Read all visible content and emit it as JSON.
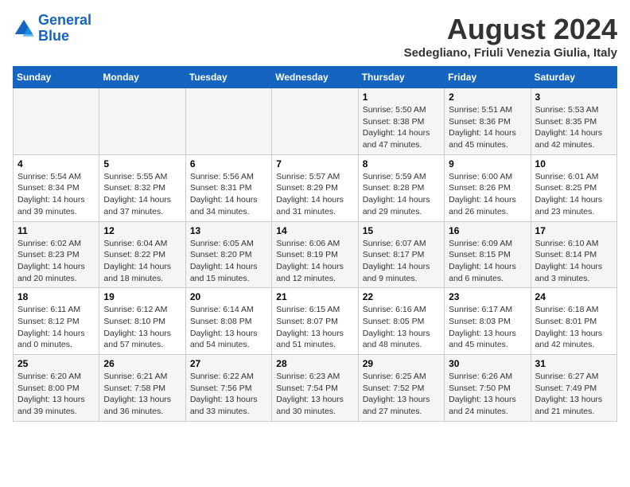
{
  "logo": {
    "line1": "General",
    "line2": "Blue"
  },
  "title": "August 2024",
  "subtitle": "Sedegliano, Friuli Venezia Giulia, Italy",
  "weekdays": [
    "Sunday",
    "Monday",
    "Tuesday",
    "Wednesday",
    "Thursday",
    "Friday",
    "Saturday"
  ],
  "weeks": [
    [
      {
        "day": "",
        "info": ""
      },
      {
        "day": "",
        "info": ""
      },
      {
        "day": "",
        "info": ""
      },
      {
        "day": "",
        "info": ""
      },
      {
        "day": "1",
        "info": "Sunrise: 5:50 AM\nSunset: 8:38 PM\nDaylight: 14 hours and 47 minutes."
      },
      {
        "day": "2",
        "info": "Sunrise: 5:51 AM\nSunset: 8:36 PM\nDaylight: 14 hours and 45 minutes."
      },
      {
        "day": "3",
        "info": "Sunrise: 5:53 AM\nSunset: 8:35 PM\nDaylight: 14 hours and 42 minutes."
      }
    ],
    [
      {
        "day": "4",
        "info": "Sunrise: 5:54 AM\nSunset: 8:34 PM\nDaylight: 14 hours and 39 minutes."
      },
      {
        "day": "5",
        "info": "Sunrise: 5:55 AM\nSunset: 8:32 PM\nDaylight: 14 hours and 37 minutes."
      },
      {
        "day": "6",
        "info": "Sunrise: 5:56 AM\nSunset: 8:31 PM\nDaylight: 14 hours and 34 minutes."
      },
      {
        "day": "7",
        "info": "Sunrise: 5:57 AM\nSunset: 8:29 PM\nDaylight: 14 hours and 31 minutes."
      },
      {
        "day": "8",
        "info": "Sunrise: 5:59 AM\nSunset: 8:28 PM\nDaylight: 14 hours and 29 minutes."
      },
      {
        "day": "9",
        "info": "Sunrise: 6:00 AM\nSunset: 8:26 PM\nDaylight: 14 hours and 26 minutes."
      },
      {
        "day": "10",
        "info": "Sunrise: 6:01 AM\nSunset: 8:25 PM\nDaylight: 14 hours and 23 minutes."
      }
    ],
    [
      {
        "day": "11",
        "info": "Sunrise: 6:02 AM\nSunset: 8:23 PM\nDaylight: 14 hours and 20 minutes."
      },
      {
        "day": "12",
        "info": "Sunrise: 6:04 AM\nSunset: 8:22 PM\nDaylight: 14 hours and 18 minutes."
      },
      {
        "day": "13",
        "info": "Sunrise: 6:05 AM\nSunset: 8:20 PM\nDaylight: 14 hours and 15 minutes."
      },
      {
        "day": "14",
        "info": "Sunrise: 6:06 AM\nSunset: 8:19 PM\nDaylight: 14 hours and 12 minutes."
      },
      {
        "day": "15",
        "info": "Sunrise: 6:07 AM\nSunset: 8:17 PM\nDaylight: 14 hours and 9 minutes."
      },
      {
        "day": "16",
        "info": "Sunrise: 6:09 AM\nSunset: 8:15 PM\nDaylight: 14 hours and 6 minutes."
      },
      {
        "day": "17",
        "info": "Sunrise: 6:10 AM\nSunset: 8:14 PM\nDaylight: 14 hours and 3 minutes."
      }
    ],
    [
      {
        "day": "18",
        "info": "Sunrise: 6:11 AM\nSunset: 8:12 PM\nDaylight: 14 hours and 0 minutes."
      },
      {
        "day": "19",
        "info": "Sunrise: 6:12 AM\nSunset: 8:10 PM\nDaylight: 13 hours and 57 minutes."
      },
      {
        "day": "20",
        "info": "Sunrise: 6:14 AM\nSunset: 8:08 PM\nDaylight: 13 hours and 54 minutes."
      },
      {
        "day": "21",
        "info": "Sunrise: 6:15 AM\nSunset: 8:07 PM\nDaylight: 13 hours and 51 minutes."
      },
      {
        "day": "22",
        "info": "Sunrise: 6:16 AM\nSunset: 8:05 PM\nDaylight: 13 hours and 48 minutes."
      },
      {
        "day": "23",
        "info": "Sunrise: 6:17 AM\nSunset: 8:03 PM\nDaylight: 13 hours and 45 minutes."
      },
      {
        "day": "24",
        "info": "Sunrise: 6:18 AM\nSunset: 8:01 PM\nDaylight: 13 hours and 42 minutes."
      }
    ],
    [
      {
        "day": "25",
        "info": "Sunrise: 6:20 AM\nSunset: 8:00 PM\nDaylight: 13 hours and 39 minutes."
      },
      {
        "day": "26",
        "info": "Sunrise: 6:21 AM\nSunset: 7:58 PM\nDaylight: 13 hours and 36 minutes."
      },
      {
        "day": "27",
        "info": "Sunrise: 6:22 AM\nSunset: 7:56 PM\nDaylight: 13 hours and 33 minutes."
      },
      {
        "day": "28",
        "info": "Sunrise: 6:23 AM\nSunset: 7:54 PM\nDaylight: 13 hours and 30 minutes."
      },
      {
        "day": "29",
        "info": "Sunrise: 6:25 AM\nSunset: 7:52 PM\nDaylight: 13 hours and 27 minutes."
      },
      {
        "day": "30",
        "info": "Sunrise: 6:26 AM\nSunset: 7:50 PM\nDaylight: 13 hours and 24 minutes."
      },
      {
        "day": "31",
        "info": "Sunrise: 6:27 AM\nSunset: 7:49 PM\nDaylight: 13 hours and 21 minutes."
      }
    ]
  ]
}
